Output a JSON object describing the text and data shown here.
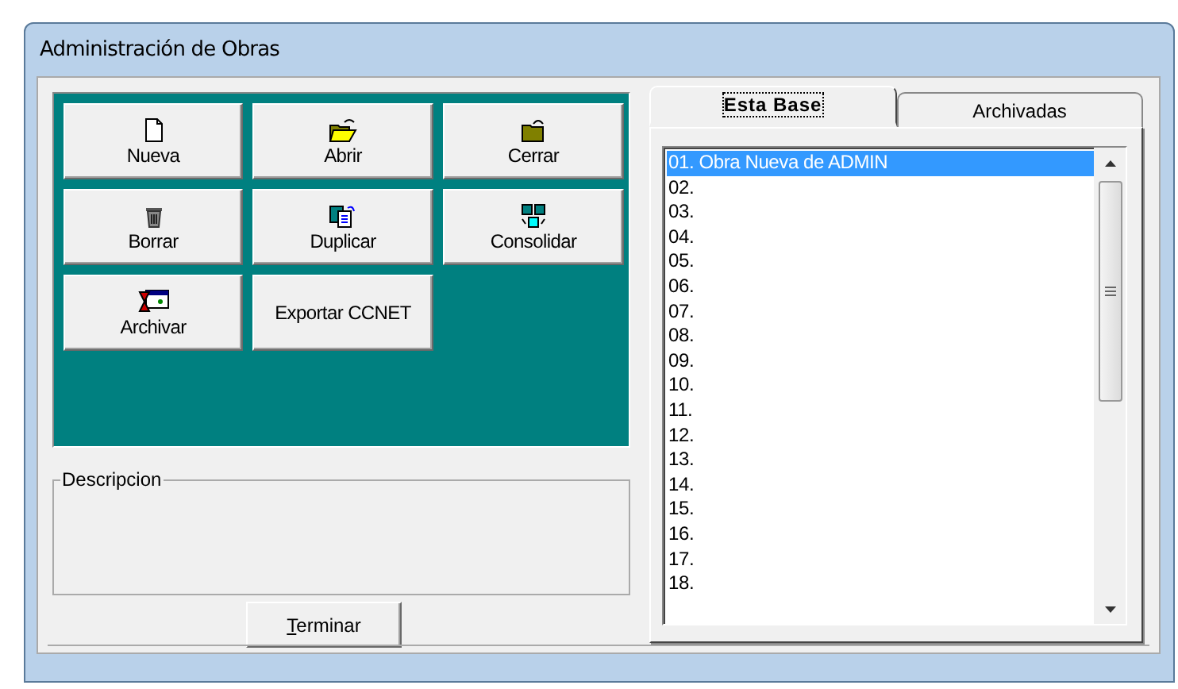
{
  "window": {
    "title": "Administración de Obras"
  },
  "buttons": [
    {
      "label": "Nueva"
    },
    {
      "label": "Abrir"
    },
    {
      "label": "Cerrar"
    },
    {
      "label": "Borrar"
    },
    {
      "label": "Duplicar"
    },
    {
      "label": "Consolidar"
    },
    {
      "label": "Archivar"
    },
    {
      "label": "Exportar CCNET"
    }
  ],
  "description": {
    "label": "Descripcion"
  },
  "finish_button": {
    "label": "Terminar",
    "first_letter_underlined": true
  },
  "tabs": [
    {
      "label": "Esta Base",
      "selected": true
    },
    {
      "label": "Archivadas",
      "selected": false
    }
  ],
  "list": [
    {
      "text": "01. Obra Nueva de ADMIN",
      "selected": true
    },
    {
      "text": "02.",
      "selected": false
    },
    {
      "text": "03.",
      "selected": false
    },
    {
      "text": "04.",
      "selected": false
    },
    {
      "text": "05.",
      "selected": false
    },
    {
      "text": "06.",
      "selected": false
    },
    {
      "text": "07.",
      "selected": false
    },
    {
      "text": "08.",
      "selected": false
    },
    {
      "text": "09.",
      "selected": false
    },
    {
      "text": "10.",
      "selected": false
    },
    {
      "text": "11.",
      "selected": false
    },
    {
      "text": "12.",
      "selected": false
    },
    {
      "text": "13.",
      "selected": false
    },
    {
      "text": "14.",
      "selected": false
    },
    {
      "text": "15.",
      "selected": false
    },
    {
      "text": "16.",
      "selected": false
    },
    {
      "text": "17.",
      "selected": false
    },
    {
      "text": "18.",
      "selected": false
    }
  ]
}
